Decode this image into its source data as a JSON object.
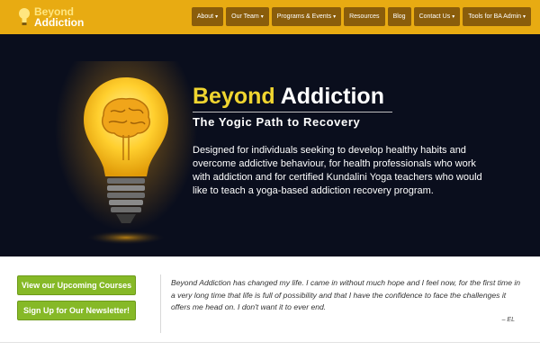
{
  "header": {
    "logo_line1": "Beyond",
    "logo_line2": "Addiction",
    "logo_icon": "lightbulb-icon",
    "brand_color": "#e8ab12",
    "nav": [
      {
        "label": "About",
        "has_dropdown": true
      },
      {
        "label": "Our Team",
        "has_dropdown": true
      },
      {
        "label": "Programs & Events",
        "has_dropdown": true
      },
      {
        "label": "Resources",
        "has_dropdown": false
      },
      {
        "label": "Blog",
        "has_dropdown": false
      },
      {
        "label": "Contact Us",
        "has_dropdown": true
      },
      {
        "label": "Tools for BA Admin",
        "has_dropdown": true
      }
    ],
    "dropdown_icon": "caret-down-icon"
  },
  "hero": {
    "title_word1": "Beyond",
    "title_word2": "Addiction",
    "subtitle": "The Yogic Path to Recovery",
    "description": "Designed for individuals seeking to develop healthy habits and overcome addictive behaviour, for health professionals who work with addiction and for certified Kundalini Yoga teachers who would like to teach a yoga-based addiction recovery program.",
    "image_icon": "lightbulb-brain-icon",
    "background_color": "#0a0e1d",
    "title_accent_color": "#f0d530"
  },
  "actions": {
    "courses_label": "View our Upcoming Courses",
    "newsletter_label": "Sign Up for Our Newsletter!",
    "button_color": "#86b927"
  },
  "testimonial": {
    "text": "Beyond Addiction has changed my life.  I came in without much hope and I feel now, for the first time in a very long time that life is full of possibility and that I have the confidence to face the challenges it offers me head on.  I don't want it to ever end.",
    "author": "– EL"
  }
}
